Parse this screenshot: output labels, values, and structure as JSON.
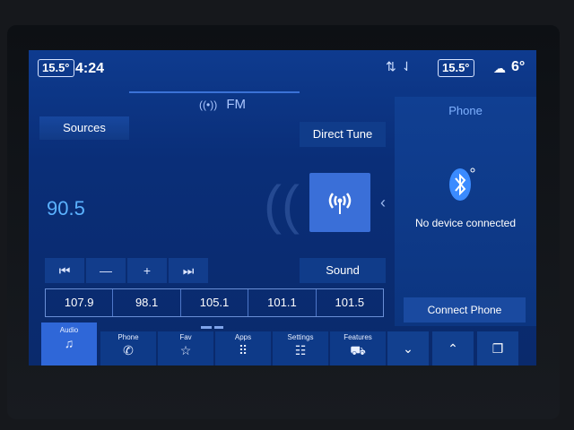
{
  "status": {
    "cabin_temp": "15.5°",
    "time": "4:24",
    "network_icon": "signal-arrows-icon",
    "zone_temp": "15.5°",
    "weather_icon": "cloud-night-icon",
    "outside_temp": "6°"
  },
  "radio": {
    "band": "FM",
    "sources_label": "Sources",
    "frequency": "90.5",
    "direct_tune_label": "Direct Tune",
    "sound_label": "Sound",
    "transport": {
      "seek_back": "⏮",
      "tune_down": "—",
      "tune_up": "+",
      "seek_forward": "⏭"
    },
    "presets": [
      "107.9",
      "98.1",
      "105.1",
      "101.1",
      "101.5"
    ]
  },
  "phone_panel": {
    "title": "Phone",
    "status_text": "No device connected",
    "connect_label": "Connect Phone"
  },
  "nav": {
    "items": [
      {
        "label": "Audio",
        "icon": "music-note-icon"
      },
      {
        "label": "Phone",
        "icon": "phone-icon"
      },
      {
        "label": "Fav",
        "icon": "star-icon"
      },
      {
        "label": "Apps",
        "icon": "apps-grid-icon"
      },
      {
        "label": "Settings",
        "icon": "settings-sliders-icon"
      },
      {
        "label": "Features",
        "icon": "car-icon"
      }
    ],
    "arrows": [
      "chevron-down-icon",
      "chevron-up-icon",
      "copy-windows-icon"
    ]
  },
  "colors": {
    "screen_bg": "#0a2e78",
    "accent_blue": "#5bb2ff",
    "active_tab": "#2f67d8"
  }
}
